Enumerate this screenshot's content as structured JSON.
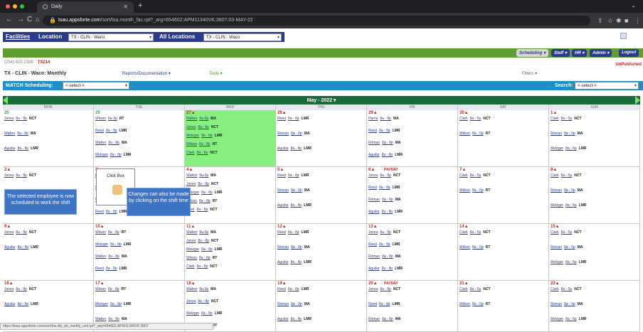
{
  "browser": {
    "tab_title": "Daily",
    "url_host": "tsau.appsforte.com",
    "url_path": "/sort/tsa.month_fac.rpt?_arg=654602:APM11340VK:3807:03-MAY-22"
  },
  "top": {
    "facilities_label": "Facilities",
    "location_label": "Location",
    "location_value": "TX - CLIN - Waco",
    "all_locations_label": "All Locations",
    "all_locations_value": "TX - CLIN - Waco"
  },
  "menu": {
    "scheduling": "Scheduling ▾",
    "staff": "Staff ▾",
    "hr": "HR ▾",
    "admin": "Admin ▾",
    "logout": "Logout"
  },
  "info": {
    "phone": "(254) 420 2336",
    "code": "TX214",
    "unpublished": "UnPublished"
  },
  "subbar": {
    "title": "TX - CLIN - Waco: Monthly",
    "reports": "Reports/Documentation ▾",
    "tools": "Tools ▾",
    "filters": "Filters ▾"
  },
  "match": {
    "label": "MATCH Scheduling:",
    "select": "<-select->",
    "search_label": "Search:",
    "search_select": "<-select->"
  },
  "calendar": {
    "month": "May - 2022 ▾",
    "days": [
      "MON",
      "TUE",
      "WED",
      "THU",
      "FRI",
      "SAT",
      "SUN"
    ],
    "weeks": [
      [
        {
          "date": "25",
          "shifts": [
            [
              "Jones",
              "8a - 8p",
              "NCT"
            ],
            [
              "Walker",
              "8a - 8p",
              "MA"
            ],
            [
              "Aguilar",
              "8a - 8p",
              "LMR"
            ]
          ]
        },
        {
          "date": "26",
          "shifts": [
            [
              "Wilson",
              "8a-3p",
              "RT"
            ],
            [
              "Reed",
              "8a - 8p",
              "LMR"
            ],
            [
              "Walker",
              "8a - 8p",
              "MA"
            ],
            [
              "Metzger",
              "8a - 8p",
              "LMR"
            ]
          ]
        },
        {
          "date": "27▲",
          "hl": true,
          "shifts": [
            [
              "Walker",
              "8a-3p",
              "MA"
            ],
            [
              "Jones",
              "8a - 8p",
              "NCT"
            ],
            [
              "Metzger",
              "8a - 8p",
              "LMR"
            ],
            [
              "Wilson",
              "8a - 8p",
              "RT"
            ],
            [
              "Clark",
              "8a - 8p",
              "NCT"
            ]
          ]
        },
        {
          "date": "28▲",
          "shifts": [
            [
              "Reed",
              "8a - 8p",
              "LMR"
            ],
            [
              "Roman",
              "8a - 8p",
              "MA"
            ],
            [
              "Aguilar",
              "8a - 8p",
              "LMR"
            ]
          ]
        },
        {
          "date": "29▲",
          "shifts": [
            [
              "Harris",
              "8a - 8p",
              "MA"
            ],
            [
              "Reed",
              "8a - 8p",
              "LMR"
            ],
            [
              "Roman",
              "8a - 8p",
              "MA"
            ],
            [
              "Aguilar",
              "8a - 8p",
              "LMR"
            ]
          ]
        },
        {
          "date": "30▲",
          "shifts": [
            [
              "Clark",
              "8a - 5p",
              "NCT"
            ],
            [
              "Wilson",
              "8a - 5p",
              "RT"
            ]
          ]
        },
        {
          "date": "1▲",
          "shifts": [
            [
              "Clark",
              "8a - 5p",
              "NCT"
            ],
            [
              "Roman",
              "8a - 5p",
              "MA"
            ],
            [
              "Metzger",
              "8a - 5p",
              "LMR"
            ]
          ]
        }
      ],
      [
        {
          "date": "2▲",
          "shifts": [
            [
              "Jones",
              "8a - 8p",
              "NCT"
            ]
          ]
        },
        {
          "date": "3▲",
          "shifts": [
            [
              "Harris",
              "8a-3p",
              "MA"
            ],
            [
              "Metzger",
              "8a - 8p",
              "LMR"
            ],
            [
              "Walker",
              "8a",
              "MA"
            ],
            [
              "Reed",
              "8a - 8p",
              "LMR"
            ]
          ]
        },
        {
          "date": "4▲",
          "shifts": [
            [
              "Walker",
              "8a-3p",
              "MA"
            ],
            [
              "Jones",
              "8a - 8p",
              "NCT"
            ],
            [
              "Metzger",
              "8a - 8p",
              "LMR"
            ],
            [
              "Wilson",
              "8a - 8p",
              "RT"
            ],
            [
              "Clark",
              "8a - 8p",
              "NCT"
            ]
          ]
        },
        {
          "date": "5▲",
          "shifts": [
            [
              "Reed",
              "8a - 8p",
              "LMR"
            ],
            [
              "Roman",
              "8a - 8p",
              "MA"
            ],
            [
              "Aguilar",
              "8a - 8p",
              "LMR"
            ]
          ]
        },
        {
          "date": "6▲",
          "payday": "PAYDAY",
          "shifts": [
            [
              "Jones",
              "8a - 8p",
              "NCT"
            ],
            [
              "Reed",
              "8a - 8p",
              "LMR"
            ],
            [
              "Roman",
              "8a - 8p",
              "MA"
            ],
            [
              "Aguilar",
              "8a - 8p",
              "LMR"
            ]
          ]
        },
        {
          "date": "7▲",
          "shifts": [
            [
              "Clark",
              "8a - 5p",
              "NCT"
            ],
            [
              "Wilson",
              "8a - 5p",
              "RT"
            ]
          ]
        },
        {
          "date": "8▲",
          "shifts": [
            [
              "Clark",
              "8a - 5p",
              "NCT"
            ],
            [
              "Roman",
              "8a - 5p",
              "MA"
            ],
            [
              "Metzger",
              "8a - 5p",
              "LMR"
            ]
          ]
        }
      ],
      [
        {
          "date": "9▲",
          "shifts": [
            [
              "Jones",
              "8a - 8p",
              "NCT"
            ],
            [
              "Aguilar",
              "8a - 8p",
              "LMR"
            ]
          ]
        },
        {
          "date": "10▲",
          "shifts": [
            [
              "Wilson",
              "8a - 8p",
              "RT"
            ],
            [
              "Metzger",
              "8a - 8p",
              "LMR"
            ],
            [
              "Walker",
              "8a - 8p",
              "MA"
            ],
            [
              "Reed",
              "8a - 8p",
              "LMR"
            ]
          ]
        },
        {
          "date": "11▲",
          "shifts": [
            [
              "Walker",
              "8a-3p",
              "MA"
            ],
            [
              "Jones",
              "8a - 8p",
              "NCT"
            ],
            [
              "Metzger",
              "8a - 8p",
              "LMR"
            ],
            [
              "Wilson",
              "8a - 8p",
              "RT"
            ],
            [
              "Clark",
              "8a - 8p",
              "NCT"
            ]
          ]
        },
        {
          "date": "12▲",
          "shifts": [
            [
              "Reed",
              "8a - 8p",
              "LMR"
            ],
            [
              "Roman",
              "8a - 8p",
              "MA"
            ],
            [
              "Aguilar",
              "8a - 8p",
              "LMR"
            ]
          ]
        },
        {
          "date": "13▲",
          "shifts": [
            [
              "Jones",
              "8a - 8p",
              "NCT"
            ],
            [
              "Reed",
              "8a - 8p",
              "LMR"
            ],
            [
              "Roman",
              "8a - 8p",
              "MA"
            ],
            [
              "Aguilar",
              "8a - 8p",
              "LMR"
            ]
          ]
        },
        {
          "date": "14▲",
          "shifts": [
            [
              "Clark",
              "8a - 5p",
              "NCT"
            ],
            [
              "Wilson",
              "8a - 5p",
              "RT"
            ]
          ]
        },
        {
          "date": "15▲",
          "shifts": [
            [
              "Clark",
              "8a - 5p",
              "NCT"
            ],
            [
              "Roman",
              "8a - 5p",
              "MA"
            ],
            [
              "Metzger",
              "8a - 5p",
              "LMR"
            ]
          ]
        }
      ],
      [
        {
          "date": "16▲",
          "shifts": [
            [
              "Jones",
              "8a - 8p",
              "NCT"
            ],
            [
              "Aguilar",
              "8a - 8p",
              "LMR"
            ]
          ]
        },
        {
          "date": "17▲",
          "shifts": [
            [
              "Wilson",
              "8a - 8p",
              "RT"
            ],
            [
              "Metzger",
              "8a - 8p",
              "LMR"
            ],
            [
              "Walker",
              "8a - 8p",
              "MA"
            ]
          ]
        },
        {
          "date": "18▲",
          "shifts": [
            [
              "Walker",
              "8a-3p",
              "MA"
            ],
            [
              "Jones",
              "8a - 8p",
              "NCT"
            ],
            [
              "Metzger",
              "8a - 8p",
              "LMR"
            ],
            [
              "Wilson",
              "8a - 8p",
              "RT"
            ]
          ]
        },
        {
          "date": "19▲",
          "shifts": [
            [
              "Reed",
              "8a - 8p",
              "LMR"
            ],
            [
              "Roman",
              "8a - 8p",
              "MA"
            ],
            [
              "Aguilar",
              "8a - 8p",
              "LMR"
            ]
          ]
        },
        {
          "date": "20▲",
          "payday": "PAYDAY",
          "shifts": [
            [
              "Jones",
              "8a - 8p",
              "NCT"
            ],
            [
              "Reed",
              "8a - 8p",
              "LMR"
            ],
            [
              "Roman",
              "8a - 8p",
              "MA"
            ]
          ]
        },
        {
          "date": "21▲",
          "shifts": [
            [
              "Clark",
              "8a - 5p",
              "NCT"
            ],
            [
              "Wilson",
              "8a - 5p",
              "RT"
            ]
          ]
        },
        {
          "date": "22▲",
          "shifts": [
            [
              "Clark",
              "8a - 5p",
              "NCT"
            ],
            [
              "Roman",
              "8a - 5p",
              "MA"
            ],
            [
              "Metzger",
              "8a - 5p",
              "LMR"
            ]
          ]
        }
      ]
    ]
  },
  "tutorial": {
    "callout1": "The selected employee is now scheduled to work the shift",
    "callout2": "Changes can also be made by clicking on the shift time",
    "click_box": "Click Box"
  },
  "status_url": "https://tsau.appsforte.com/sort/tsa.dly_rpt_modify_unit.rpt?_arg=654602:APM11340VK:3807"
}
